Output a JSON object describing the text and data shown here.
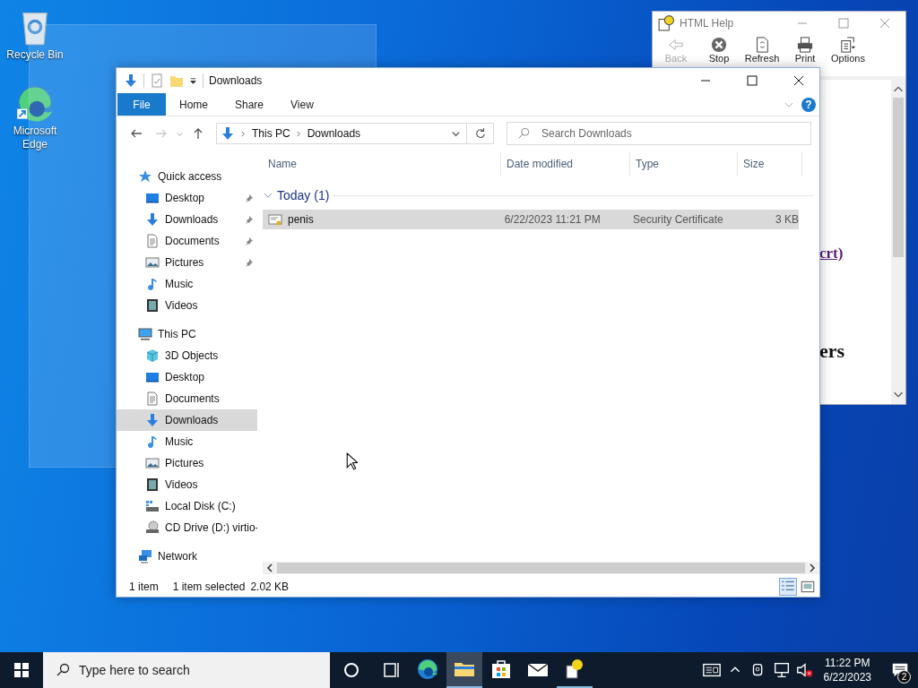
{
  "desktop": {
    "icons": [
      {
        "label": "Recycle Bin",
        "kind": "recycle"
      },
      {
        "label": "Microsoft Edge",
        "kind": "edge"
      }
    ]
  },
  "help_window": {
    "title": "HTML Help",
    "toolbar": [
      {
        "label": "Back",
        "kind": "back",
        "disabled": true
      },
      {
        "label": "Stop",
        "kind": "stop",
        "disabled": false
      },
      {
        "label": "Refresh",
        "kind": "refresh",
        "disabled": false
      },
      {
        "label": "Print",
        "kind": "print",
        "disabled": false
      },
      {
        "label": "Options",
        "kind": "options",
        "disabled": false
      }
    ],
    "content": {
      "link": "crt)",
      "heading": "ers"
    }
  },
  "explorer": {
    "title": "Downloads",
    "ribbon_tabs": [
      {
        "label": "File",
        "kind": "file"
      },
      {
        "label": "Home",
        "kind": "tab"
      },
      {
        "label": "Share",
        "kind": "tab"
      },
      {
        "label": "View",
        "kind": "tab"
      }
    ],
    "help_button": "?",
    "address": [
      "This PC",
      "Downloads"
    ],
    "search": {
      "placeholder": "Search Downloads"
    },
    "nav": [
      {
        "label": "Quick access",
        "kind": "star",
        "selected": false,
        "children": [
          {
            "label": "Desktop",
            "kind": "desktop",
            "pinned": true,
            "selected": false
          },
          {
            "label": "Downloads",
            "kind": "downloads",
            "pinned": true,
            "selected": false
          },
          {
            "label": "Documents",
            "kind": "documents",
            "pinned": true,
            "selected": false
          },
          {
            "label": "Pictures",
            "kind": "pictures",
            "pinned": true,
            "selected": false
          },
          {
            "label": "Music",
            "kind": "music",
            "pinned": false,
            "selected": false
          },
          {
            "label": "Videos",
            "kind": "videos",
            "pinned": false,
            "selected": false
          }
        ]
      },
      {
        "label": "This PC",
        "kind": "pc",
        "selected": false,
        "children": [
          {
            "label": "3D Objects",
            "kind": "objects",
            "selected": false
          },
          {
            "label": "Desktop",
            "kind": "desktop",
            "selected": false
          },
          {
            "label": "Documents",
            "kind": "documents",
            "selected": false
          },
          {
            "label": "Downloads",
            "kind": "downloads",
            "selected": true
          },
          {
            "label": "Music",
            "kind": "music",
            "selected": false
          },
          {
            "label": "Pictures",
            "kind": "pictures",
            "selected": false
          },
          {
            "label": "Videos",
            "kind": "videos",
            "selected": false
          },
          {
            "label": "Local Disk (C:)",
            "kind": "disk",
            "selected": false
          },
          {
            "label": "CD Drive (D:) virtio-",
            "kind": "cd",
            "selected": false
          }
        ]
      },
      {
        "label": "Network",
        "kind": "network",
        "selected": false
      }
    ],
    "columns": [
      "Name",
      "Date modified",
      "Type",
      "Size"
    ],
    "groups": [
      {
        "label": "Today (1)",
        "expanded": true,
        "rows": [
          {
            "name": "penis",
            "date": "6/22/2023 11:21 PM",
            "type": "Security Certificate",
            "size": "3 KB",
            "selected": true
          }
        ]
      }
    ],
    "status": {
      "count": "1 item",
      "selection": "1 item selected",
      "size": "2.02 KB"
    }
  },
  "taskbar": {
    "search": {
      "placeholder": "Type here to search"
    },
    "apps": [
      {
        "kind": "edge",
        "open": false,
        "active": false
      },
      {
        "kind": "explorer",
        "open": true,
        "active": true
      },
      {
        "kind": "store",
        "open": false,
        "active": false
      },
      {
        "kind": "mail",
        "open": false,
        "active": false
      },
      {
        "kind": "help",
        "open": true,
        "active": false
      }
    ],
    "volume_muted": true,
    "time": "11:22 PM",
    "date": "6/22/2023",
    "notifications": "2"
  }
}
